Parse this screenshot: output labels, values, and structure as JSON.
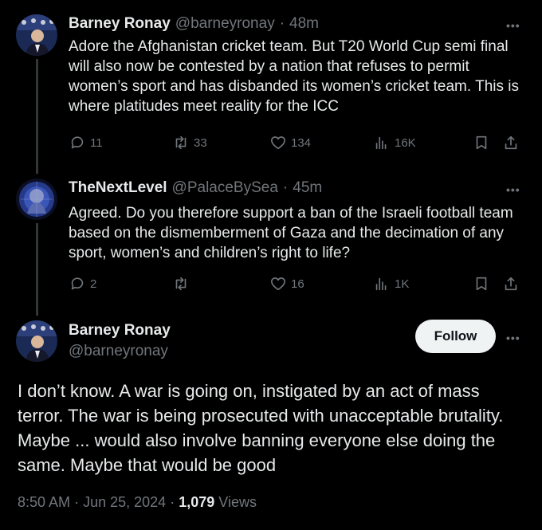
{
  "tweet1": {
    "name": "Barney Ronay",
    "handle": "@barneyronay",
    "time": "48m",
    "text": "Adore the Afghanistan cricket team. But T20 World Cup semi final will also now be contested by a nation that refuses to permit women’s sport and has disbanded its women’s cricket team. This is where platitudes meet reality for the ICC",
    "replies": "11",
    "reposts": "33",
    "likes": "134",
    "views": "16K"
  },
  "tweet2": {
    "name": "TheNextLevel",
    "handle": "@PalaceBySea",
    "time": "45m",
    "text": "Agreed. Do you therefore support a ban of the Israeli football team based on the dismemberment of Gaza and the decimation of any sport, women’s and children’s right to life?",
    "replies": "2",
    "reposts": "",
    "likes": "16",
    "views": "1K"
  },
  "main": {
    "name": "Barney Ronay",
    "handle": "@barneyronay",
    "follow_label": "Follow",
    "text": "I don’t know. A war is going on, instigated by an act of mass terror. The war is being prosecuted with unacceptable brutality. Maybe ... would also involve banning everyone else doing the same. Maybe that would be good",
    "time": "8:50 AM",
    "date": "Jun 25, 2024",
    "views_count": "1,079",
    "views_label": "Views"
  },
  "separator": "·",
  "more_glyph": "•••",
  "colors": {
    "background": "#000000",
    "text": "#e7e9ea",
    "secondary": "#71767b",
    "follow_bg": "#eff3f4"
  }
}
